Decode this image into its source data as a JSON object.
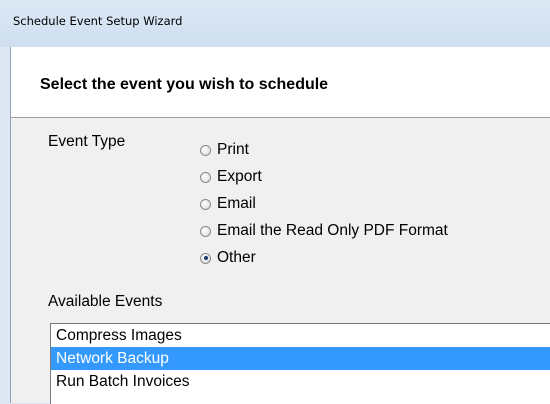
{
  "window": {
    "title": "Schedule Event Setup Wizard"
  },
  "header": {
    "heading": "Select the event you wish to schedule"
  },
  "event_type": {
    "label": "Event Type",
    "options": [
      {
        "label": "Print",
        "checked": false
      },
      {
        "label": "Export",
        "checked": false
      },
      {
        "label": "Email",
        "checked": false
      },
      {
        "label": "Email the Read Only PDF Format",
        "checked": false
      },
      {
        "label": "Other",
        "checked": true
      }
    ]
  },
  "available_events": {
    "label": "Available Events",
    "items": [
      {
        "label": "Compress Images",
        "selected": false
      },
      {
        "label": "Network Backup",
        "selected": true
      },
      {
        "label": "Run Batch Invoices",
        "selected": false
      }
    ]
  },
  "colors": {
    "selection": "#3399ff",
    "titlebar": "#d6e4f3",
    "panel": "#f0f0f0"
  }
}
